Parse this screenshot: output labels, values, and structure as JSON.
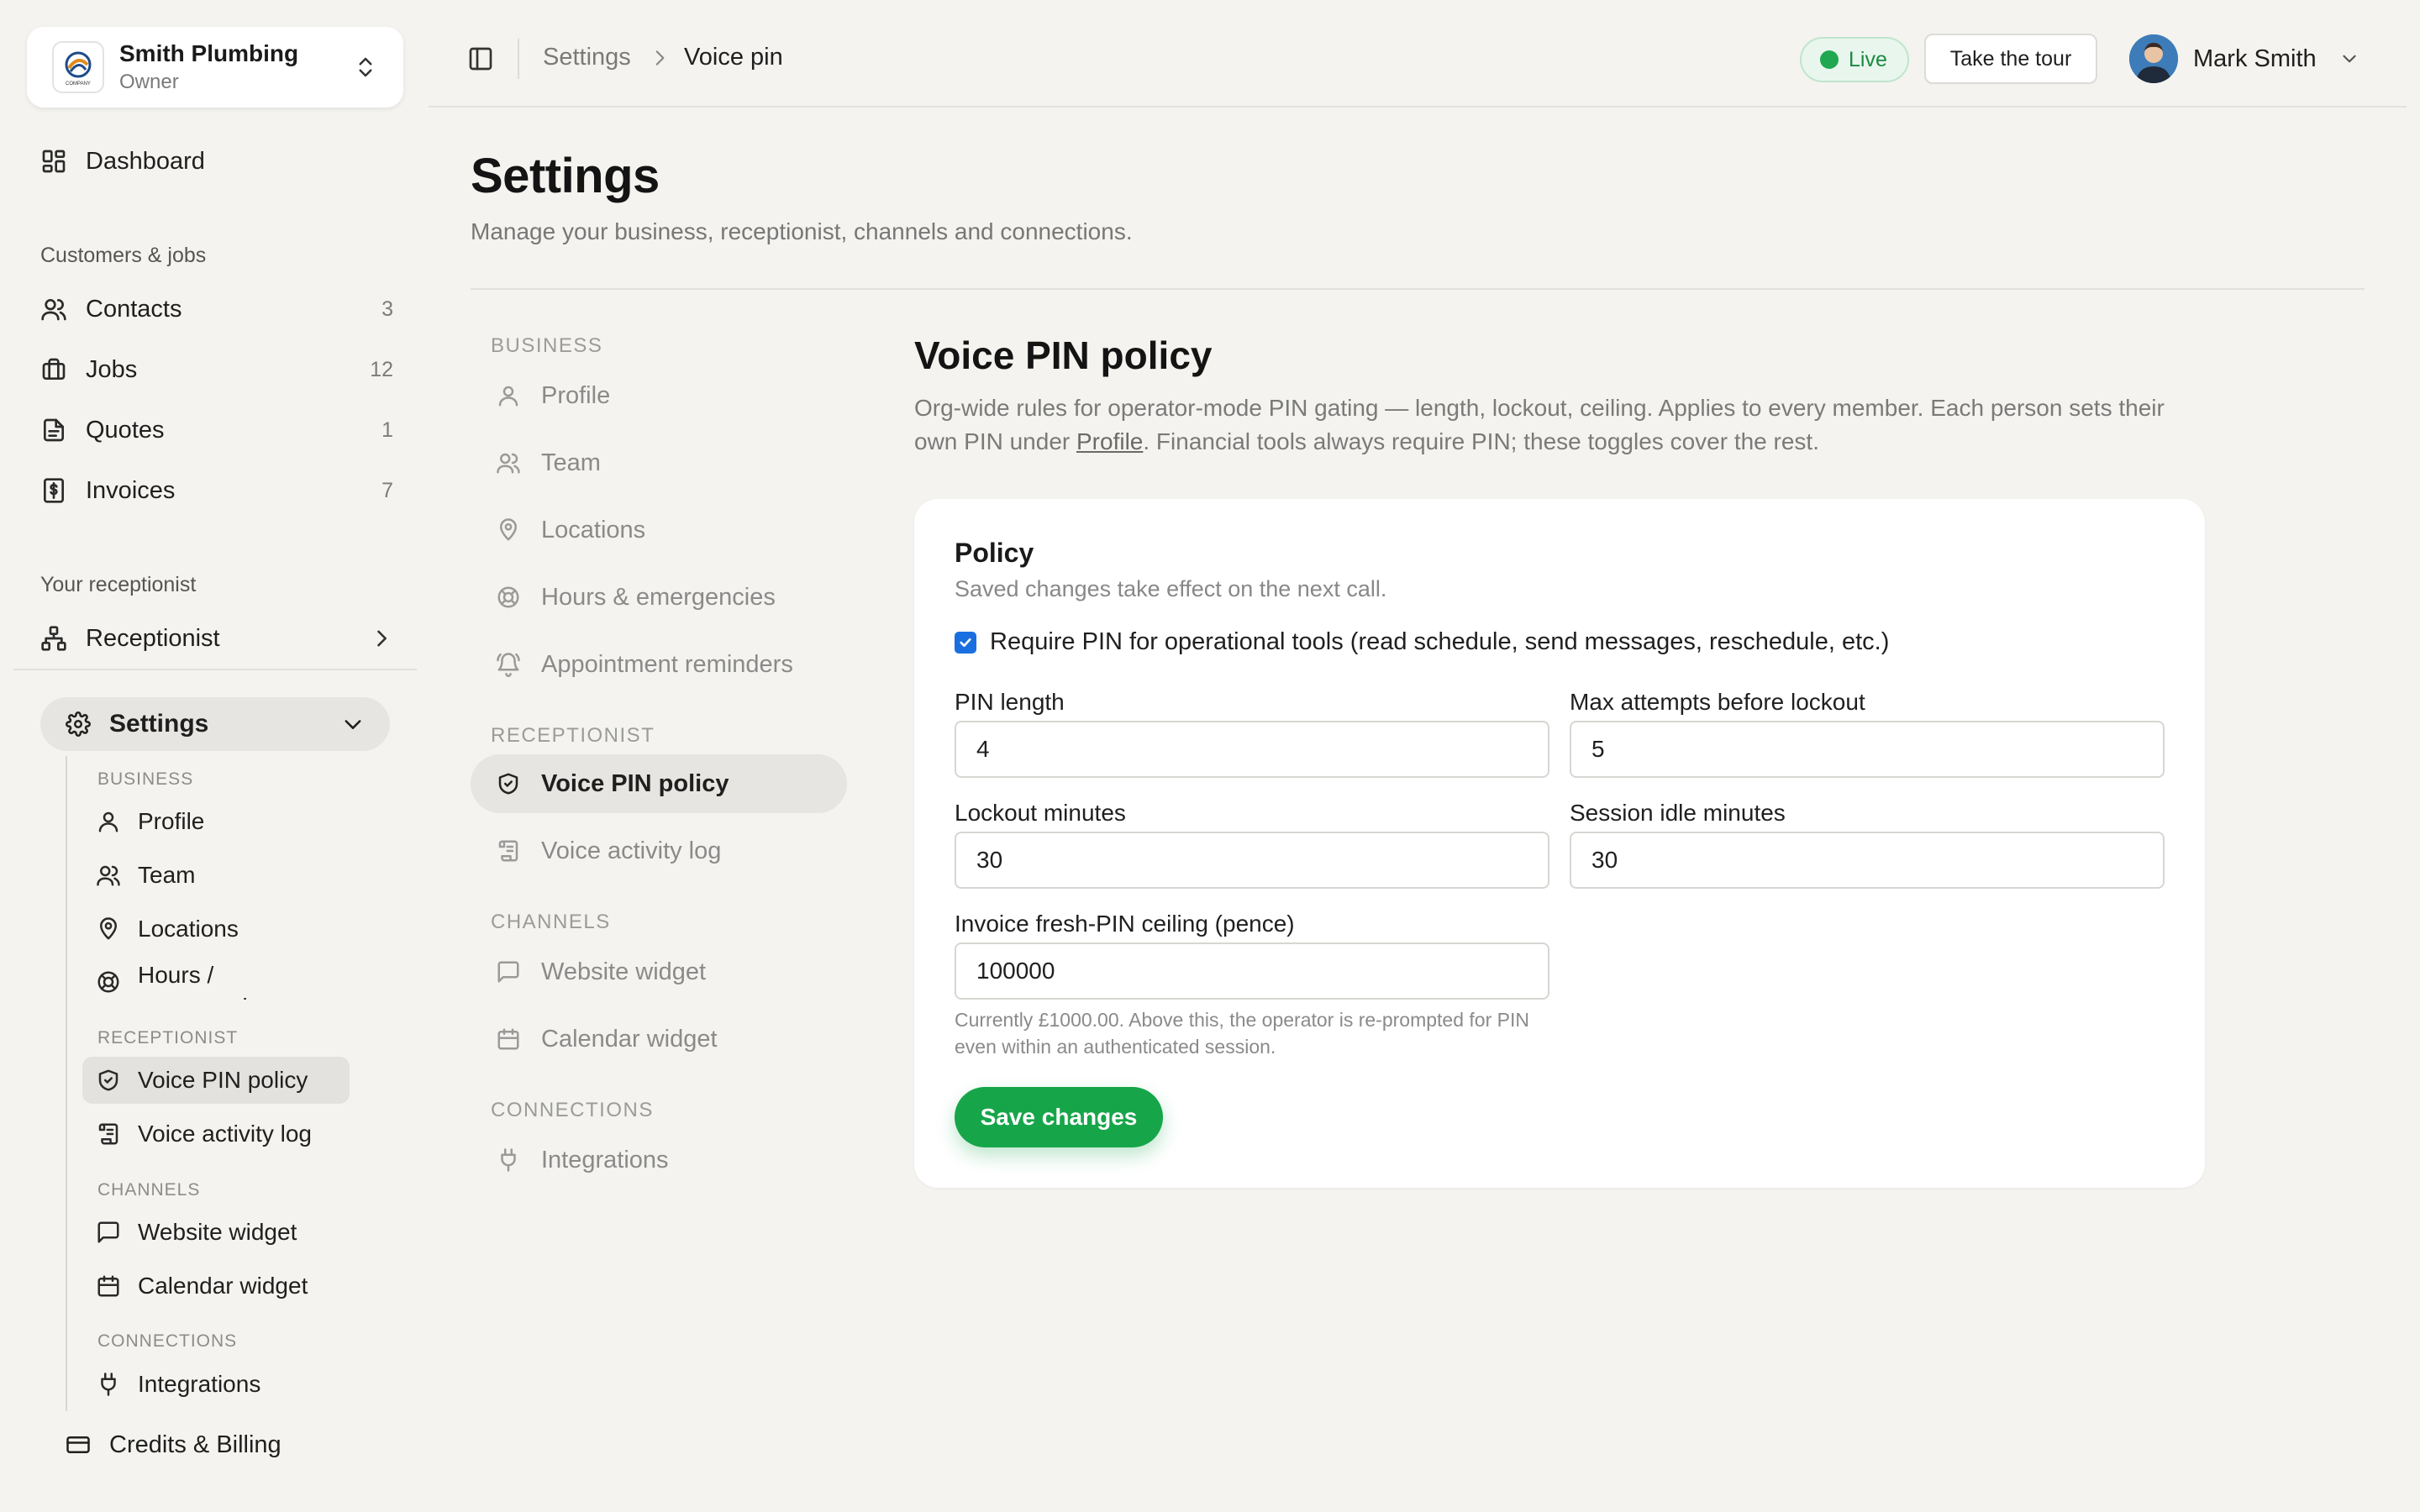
{
  "org": {
    "name": "Smith Plumbing",
    "role": "Owner",
    "logo_text": "COMPANY"
  },
  "sidebar": {
    "dashboard": "Dashboard",
    "customers_heading": "Customers & jobs",
    "items": [
      {
        "label": "Contacts",
        "count": "3"
      },
      {
        "label": "Jobs",
        "count": "12"
      },
      {
        "label": "Quotes",
        "count": "1"
      },
      {
        "label": "Invoices",
        "count": "7"
      }
    ],
    "receptionist_heading": "Your receptionist",
    "receptionist": "Receptionist",
    "settings": "Settings",
    "sub": {
      "business_heading": "BUSINESS",
      "profile": "Profile",
      "team": "Team",
      "locations": "Locations",
      "hours": "Hours / emergencies",
      "receptionist_heading": "RECEPTIONIST",
      "voice_pin": "Voice PIN policy",
      "voice_log": "Voice activity log",
      "channels_heading": "CHANNELS",
      "website_widget": "Website widget",
      "calendar_widget": "Calendar widget",
      "connections_heading": "CONNECTIONS",
      "integrations": "Integrations"
    },
    "credits": "Credits & Billing"
  },
  "topbar": {
    "breadcrumb": [
      "Settings",
      "Voice pin"
    ],
    "live": "Live",
    "tour": "Take the tour",
    "user": "Mark Smith"
  },
  "page": {
    "title": "Settings",
    "subtitle": "Manage your business, receptionist, channels and connections."
  },
  "settings_nav": {
    "business_heading": "BUSINESS",
    "profile": "Profile",
    "team": "Team",
    "locations": "Locations",
    "hours": "Hours & emergencies",
    "reminders": "Appointment reminders",
    "receptionist_heading": "RECEPTIONIST",
    "voice_pin": "Voice PIN policy",
    "voice_log": "Voice activity log",
    "channels_heading": "CHANNELS",
    "website_widget": "Website widget",
    "calendar_widget": "Calendar widget",
    "connections_heading": "CONNECTIONS",
    "integrations": "Integrations"
  },
  "content": {
    "title": "Voice PIN policy",
    "desc_1": "Org-wide rules for operator-mode PIN gating — length, lockout, ceiling. Applies to every member. Each person sets their own PIN under ",
    "desc_link": "Profile",
    "desc_2": ". Financial tools always require PIN; these toggles cover the rest."
  },
  "policy": {
    "title": "Policy",
    "subtitle": "Saved changes take effect on the next call.",
    "require_pin_label": "Require PIN for operational tools (read schedule, send messages, reschedule, etc.)",
    "require_pin_checked": true,
    "pin_length_label": "PIN length",
    "pin_length": "4",
    "max_attempts_label": "Max attempts before lockout",
    "max_attempts": "5",
    "lockout_label": "Lockout minutes",
    "lockout": "30",
    "idle_label": "Session idle minutes",
    "idle": "30",
    "ceiling_label": "Invoice fresh-PIN ceiling (pence)",
    "ceiling": "100000",
    "ceiling_help": "Currently £1000.00. Above this, the operator is re-prompted for PIN even within an authenticated session.",
    "save": "Save changes"
  },
  "colors": {
    "accent": "#17a54a",
    "live": "#1fa84f",
    "checkbox": "#1a6fe0",
    "background": "#f4f3ef"
  }
}
